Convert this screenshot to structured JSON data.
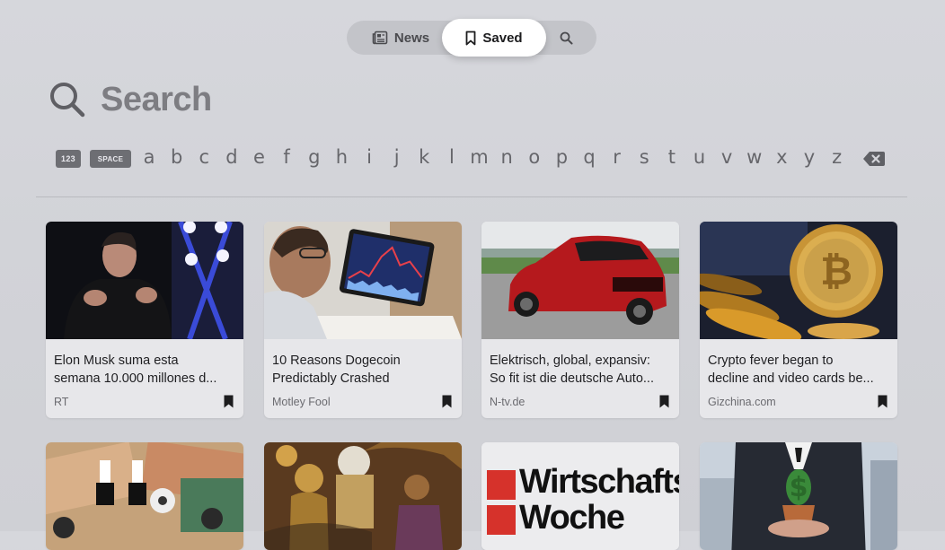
{
  "tabs": {
    "news_label": "News",
    "saved_label": "Saved",
    "selected": "Saved"
  },
  "search": {
    "title": "Search"
  },
  "keyboard": {
    "key_123": "123",
    "key_space": "SPACE",
    "letters": [
      "a",
      "b",
      "c",
      "d",
      "e",
      "f",
      "g",
      "h",
      "i",
      "j",
      "k",
      "l",
      "m",
      "n",
      "o",
      "p",
      "q",
      "r",
      "s",
      "t",
      "u",
      "v",
      "w",
      "x",
      "y",
      "z"
    ]
  },
  "cards": [
    {
      "title_line1": "Elon Musk suma esta",
      "title_line2": "semana 10.000 millones d...",
      "source": "RT",
      "bookmarked": true,
      "image": "man-speaking-on-stage"
    },
    {
      "title_line1": "10 Reasons Dogecoin",
      "title_line2": "Predictably Crashed",
      "source": "Motley Fool",
      "bookmarked": true,
      "image": "person-viewing-stock-chart-tablet"
    },
    {
      "title_line1": "Elektrisch, global, expansiv:",
      "title_line2": "So fit ist die deutsche Auto...",
      "source": "N-tv.de",
      "bookmarked": true,
      "image": "red-suv"
    },
    {
      "title_line1": "Crypto fever began to",
      "title_line2": "decline and video cards be...",
      "source": "Gizchina.com",
      "bookmarked": true,
      "image": "bitcoin-coins"
    },
    {
      "image": "euro-banknotes-figures"
    },
    {
      "image": "painted-historical-figures"
    },
    {
      "image": "wirtschaftswoche-logo",
      "logo_line1": "Wirtschafts",
      "logo_line2": "Woche"
    },
    {
      "image": "businessman-holding-dollar-plant"
    }
  ],
  "colors": {
    "background": "#d4d5da",
    "selected_tab": "#ffffff",
    "card_bg": "#e7e7ea",
    "logo_red": "#d6322b"
  }
}
